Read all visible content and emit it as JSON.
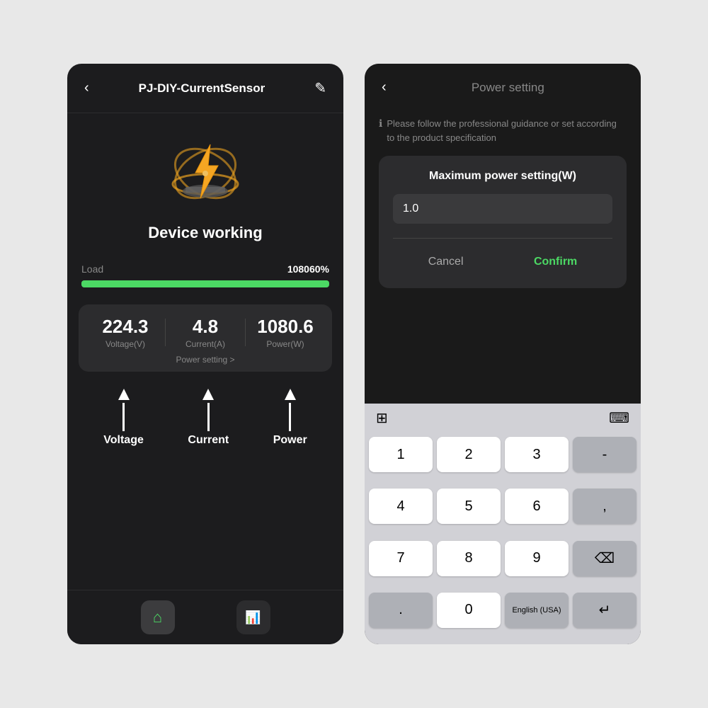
{
  "leftPanel": {
    "header": {
      "title": "PJ-DIY-CurrentSensor",
      "backIcon": "‹",
      "editIcon": "✎"
    },
    "deviceStatus": "Device working",
    "load": {
      "label": "Load",
      "value": "108060%",
      "progress": 100
    },
    "metrics": [
      {
        "value": "224.3",
        "unit": "Voltage(V)"
      },
      {
        "value": "4.8",
        "unit": "Current(A)"
      },
      {
        "value": "1080.6",
        "unit": "Power(W)"
      }
    ],
    "powerSettingLink": "Power setting >",
    "arrows": [
      {
        "label": "Voltage"
      },
      {
        "label": "Current"
      },
      {
        "label": "Power"
      }
    ],
    "footer": {
      "homeIcon": "⌂",
      "chartIcon": "📊"
    }
  },
  "rightPanel": {
    "header": {
      "backIcon": "‹",
      "title": "Power setting"
    },
    "infoText": "Please follow the professional guidance or set according to the product specification",
    "dialog": {
      "title": "Maximum power setting(W)",
      "inputValue": "1.0",
      "cancelLabel": "Cancel",
      "confirmLabel": "Confirm"
    },
    "keyboard": {
      "toolbarLeftIcon": "⊞",
      "toolbarRightIcon": "⌨",
      "keys": [
        [
          "1",
          "2",
          "3",
          "-"
        ],
        [
          "4",
          "5",
          "6",
          ","
        ],
        [
          "7",
          "8",
          "9",
          "⌫"
        ],
        [
          ".",
          "0",
          "English (USA)",
          "↵"
        ]
      ]
    }
  }
}
